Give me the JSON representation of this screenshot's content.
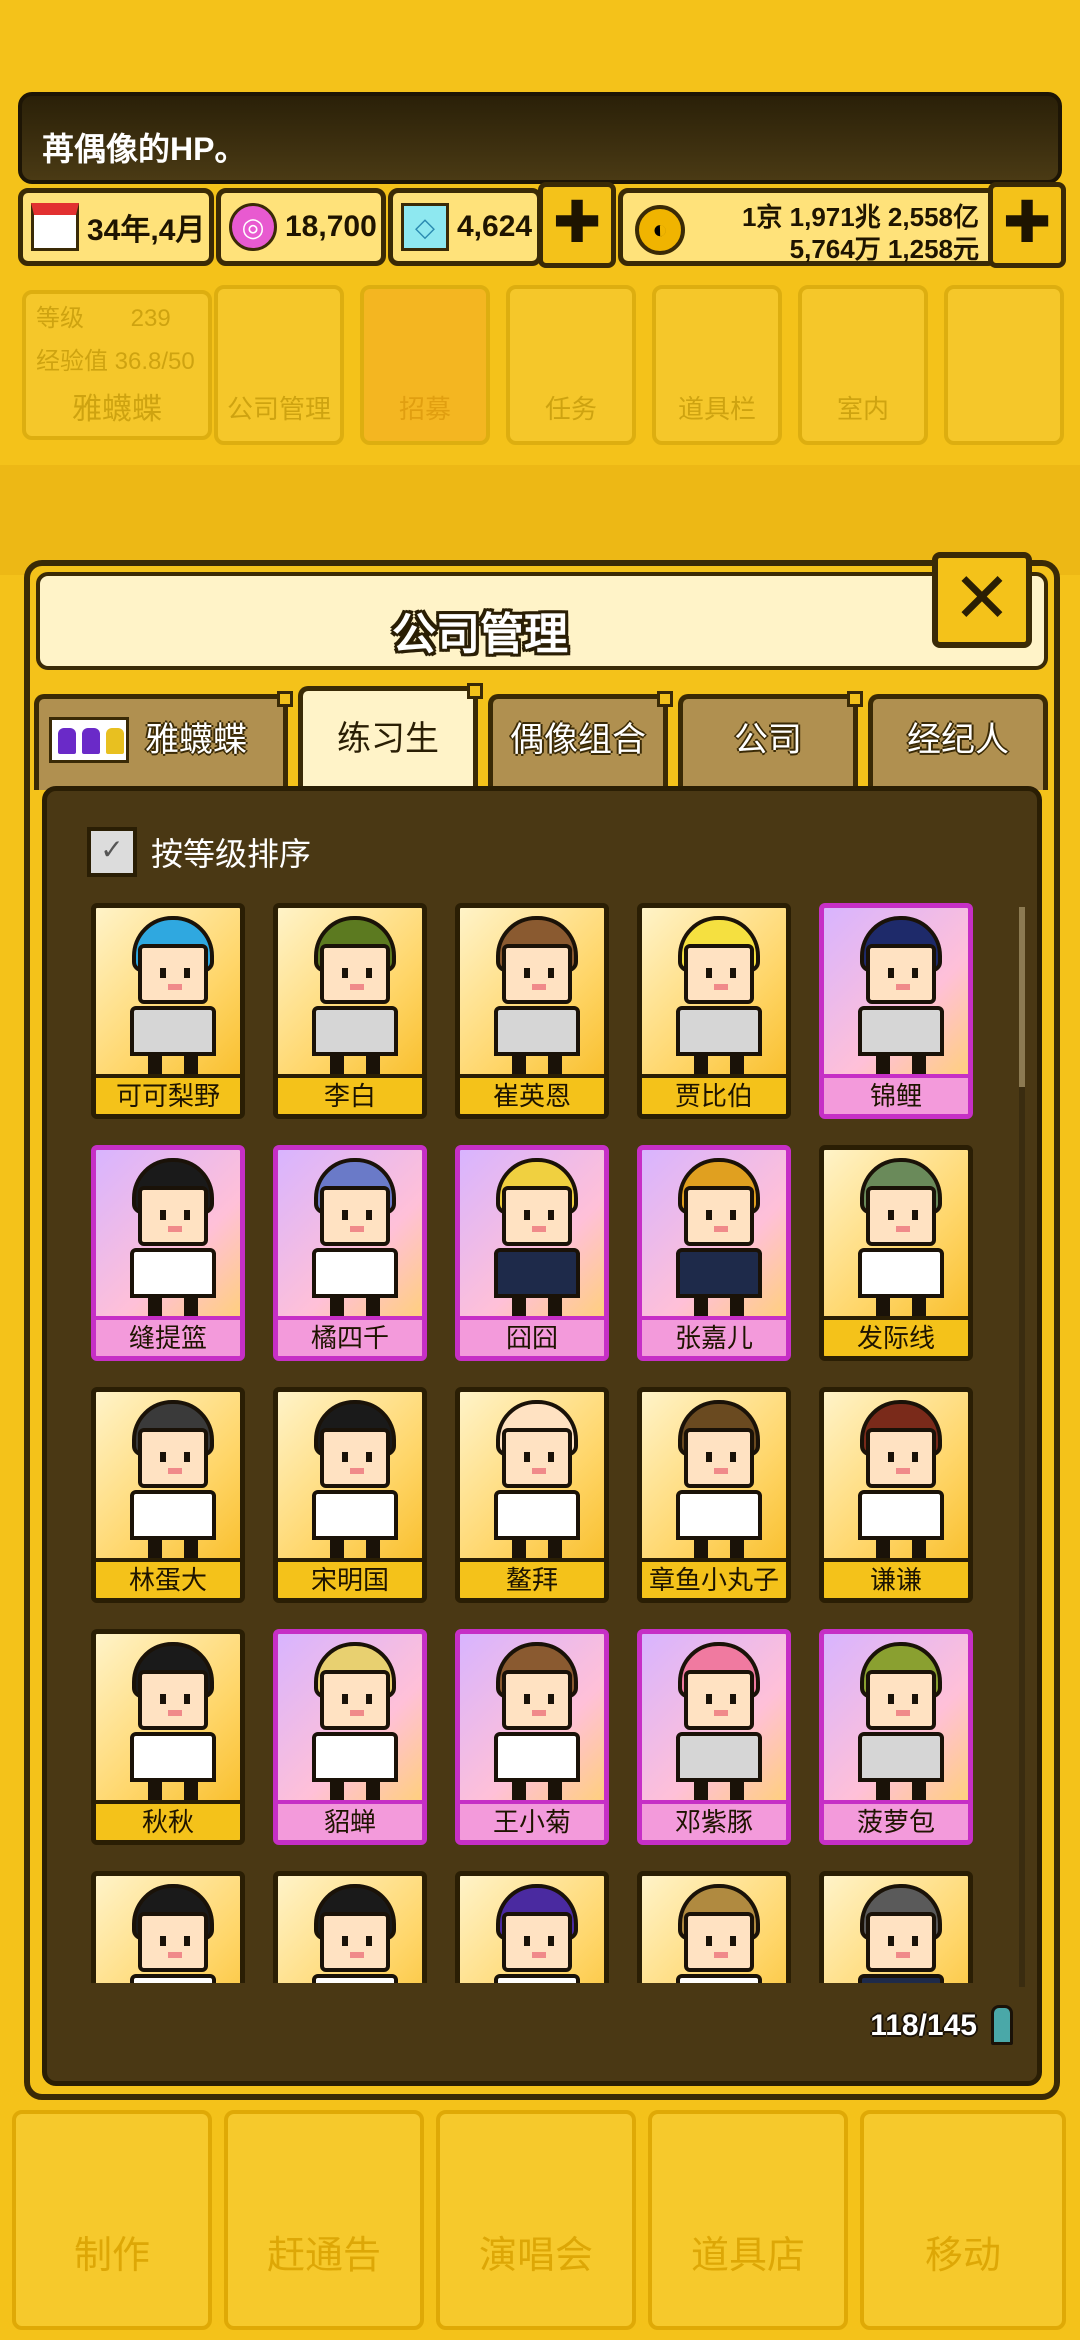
{
  "message": {
    "text": "苒偶像的HP。"
  },
  "resources": {
    "date": "34年,4月",
    "pink_currency": "18,700",
    "diamond": "4,624",
    "money_line1": "1京 1,971兆 2,558亿",
    "money_line2": "5,764万 1,258元",
    "plus_label": "✚"
  },
  "hud": {
    "level_label": "等级",
    "level_value": "239",
    "exp_label": "经验值 36.8/50",
    "player_name": "雅蠛蝶",
    "buttons": [
      "公司管理",
      "招募",
      "任务",
      "道具栏",
      "室内"
    ]
  },
  "bottom_nav": [
    "制作",
    "赶通告",
    "演唱会",
    "道具店",
    "移动"
  ],
  "dialog": {
    "title": "公司管理",
    "close_label": "✕",
    "tabs": [
      "雅蠛蝶",
      "练习生",
      "偶像组合",
      "公司",
      "经纪人"
    ],
    "active_tab": 1,
    "sort_label": "按等级排序",
    "sort_check": "✓",
    "count": "118/145"
  },
  "trainees": [
    {
      "name": "可可梨野",
      "rare": false,
      "hair": "#2FA8E0",
      "outfit": "#D6D6D6"
    },
    {
      "name": "李白",
      "rare": false,
      "hair": "#5C7A20",
      "outfit": "#D6D6D6"
    },
    {
      "name": "崔英恩",
      "rare": false,
      "hair": "#8A5A30",
      "outfit": "#D6D6D6"
    },
    {
      "name": "贾比伯",
      "rare": false,
      "hair": "#F5E040",
      "outfit": "#D6D6D6"
    },
    {
      "name": "锦鲤",
      "rare": true,
      "hair": "#1E2A6A",
      "outfit": "#D6D6D6"
    },
    {
      "name": "缝提篮",
      "rare": true,
      "hair": "#1A1A1A",
      "outfit": "#FFFFFF"
    },
    {
      "name": "橘四千",
      "rare": true,
      "hair": "#6A7AC8",
      "outfit": "#FFFFFF"
    },
    {
      "name": "囧囧",
      "rare": true,
      "hair": "#F0D040",
      "outfit": "#1E2A4A"
    },
    {
      "name": "张嘉儿",
      "rare": true,
      "hair": "#E0A020",
      "outfit": "#1E2A4A"
    },
    {
      "name": "发际线",
      "rare": false,
      "hair": "#6A8A5A",
      "outfit": "#FFFFFF"
    },
    {
      "name": "林蛋大",
      "rare": false,
      "hair": "#3A3A3A",
      "outfit": "#FFFFFF"
    },
    {
      "name": "宋明国",
      "rare": false,
      "hair": "#1A1A1A",
      "outfit": "#FFFFFF"
    },
    {
      "name": "鳌拜",
      "rare": false,
      "hair": "#FFE2C2",
      "outfit": "#FFFFFF"
    },
    {
      "name": "章鱼小丸子",
      "rare": false,
      "hair": "#6A4A20",
      "outfit": "#FFFFFF"
    },
    {
      "name": "谦谦",
      "rare": false,
      "hair": "#7A2A1A",
      "outfit": "#FFFFFF"
    },
    {
      "name": "秋秋",
      "rare": false,
      "hair": "#1A1A1A",
      "outfit": "#FFFFFF"
    },
    {
      "name": "貂蝉",
      "rare": true,
      "hair": "#E8D070",
      "outfit": "#FFFFFF"
    },
    {
      "name": "王小菊",
      "rare": true,
      "hair": "#8A5A30",
      "outfit": "#FFFFFF"
    },
    {
      "name": "邓紫豚",
      "rare": true,
      "hair": "#F07AA0",
      "outfit": "#D6D6D6"
    },
    {
      "name": "菠萝包",
      "rare": true,
      "hair": "#8AA030",
      "outfit": "#D6D6D6"
    },
    {
      "name": "",
      "rare": false,
      "hair": "#1A1A1A",
      "outfit": "#FFFFFF"
    },
    {
      "name": "",
      "rare": false,
      "hair": "#1A1A1A",
      "outfit": "#FFFFFF"
    },
    {
      "name": "",
      "rare": false,
      "hair": "#4A2AA0",
      "outfit": "#FFFFFF"
    },
    {
      "name": "",
      "rare": false,
      "hair": "#B08A40",
      "outfit": "#FFFFFF"
    },
    {
      "name": "",
      "rare": false,
      "hair": "#5A5A5A",
      "outfit": "#1E2A4A"
    }
  ]
}
